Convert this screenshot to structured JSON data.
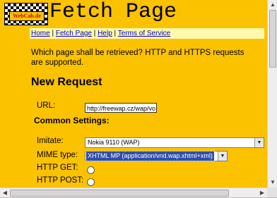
{
  "header": {
    "logo_text": "WebCab.de",
    "title": "Fetch Page"
  },
  "nav": {
    "home": "Home",
    "fetch_page": "Fetch Page",
    "help": "Help",
    "terms": "Terms of Service",
    "separator": "|"
  },
  "intro": "Which page shall be retrieved? HTTP and HTTPS requests are supported.",
  "section_title": "New Request",
  "form": {
    "url_label": "URL:",
    "url_value": "http://freewap.cz/wap/vo",
    "common_title": "Common Settings:",
    "imitate_label": "Imitate:",
    "imitate_value": "Nokia 9110 (WAP)",
    "mime_label": "MIME type:",
    "mime_value": "XHTML MP (application/vnd.wap.xhtml+xml)",
    "get_label": "HTTP GET:",
    "post_label": "HTTP POST:"
  },
  "colors": {
    "background": "#fbc200",
    "navbar": "#fff9b0",
    "link": "#0000cc",
    "selection": "#2e4fa8"
  }
}
